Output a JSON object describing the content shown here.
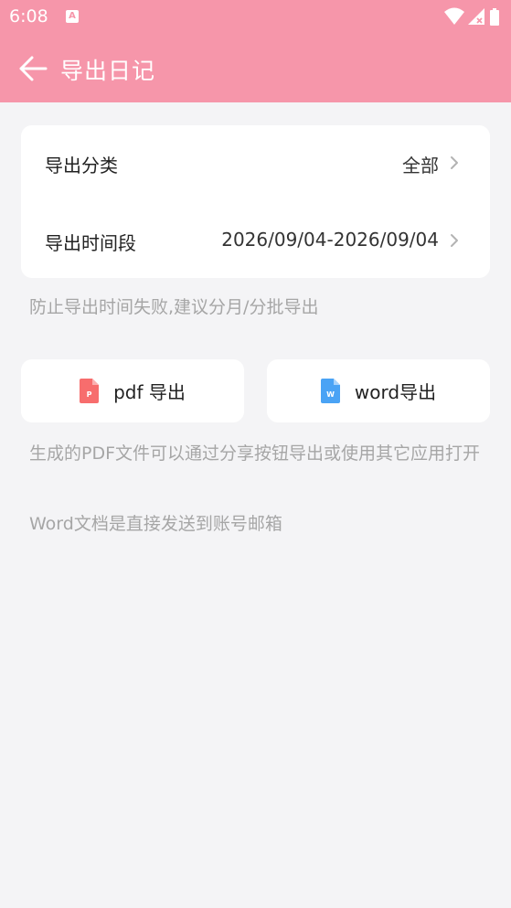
{
  "status_bar": {
    "time": "6:08",
    "notification_letter": "A"
  },
  "app_bar": {
    "title": "导出日记"
  },
  "export_settings": {
    "category_label": "导出分类",
    "category_value": "全部",
    "period_label": "导出时间段",
    "period_start": "2026/09/04",
    "period_separator": "-",
    "period_end": "2026/09/04"
  },
  "hint_top": "防止导出时间失败,建议分月/分批导出",
  "buttons": {
    "pdf": {
      "label": "pdf 导出",
      "icon_letter": "P",
      "icon_color": "#f76d6d"
    },
    "word": {
      "label": "word导出",
      "icon_letter": "W",
      "icon_color": "#4aa3f5"
    }
  },
  "hint_pdf": "生成的PDF文件可以通过分享按钮导出或使用其它应用打开",
  "hint_word": "Word文档是直接发送到账号邮箱",
  "colors": {
    "accent": "#f696aa",
    "background": "#f4f4f6"
  }
}
